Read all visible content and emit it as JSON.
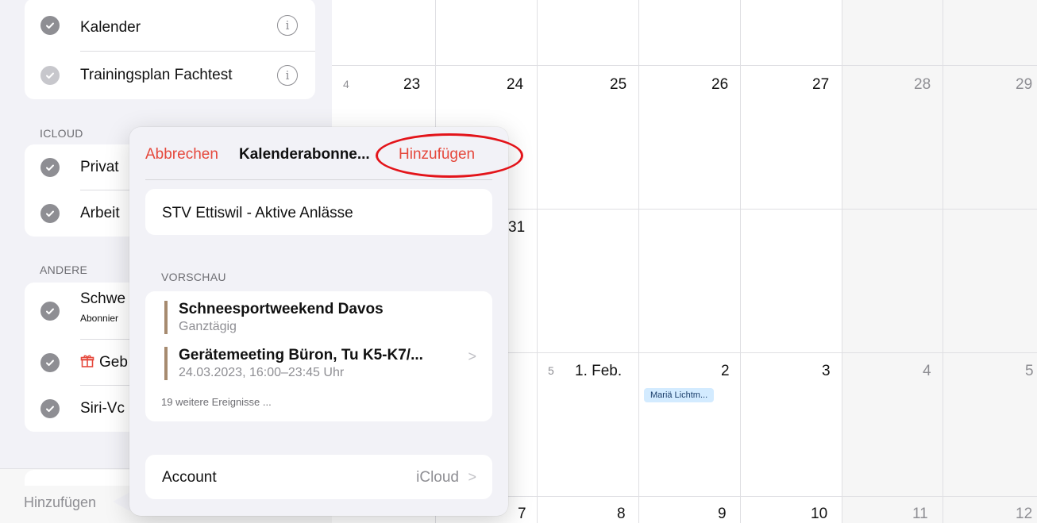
{
  "sidebar": {
    "group_top": [
      {
        "label": "Kalender",
        "checked": true
      },
      {
        "label": "Trainingsplan Fachtest",
        "checked": true
      }
    ],
    "sections": {
      "icloud": "ICLOUD",
      "other": "ANDERE"
    },
    "icloud_items": [
      {
        "label": "Privat"
      },
      {
        "label": "Arbeit"
      }
    ],
    "other_items": [
      {
        "label": "Schwe",
        "sub": "Abonnier"
      },
      {
        "label": "Geb",
        "icon": "gift-icon"
      },
      {
        "label": "Siri-Vc"
      }
    ],
    "add_button": "Hinzufügen",
    "info_glyph": "i"
  },
  "calendar": {
    "rows": [
      {
        "week": "4",
        "days": [
          "23",
          "24",
          "25",
          "26",
          "27",
          "28",
          "29"
        ]
      },
      {
        "week": "",
        "days": [
          "31"
        ]
      },
      {
        "week": "5",
        "days": [
          "1. Feb.",
          "2",
          "3",
          "4",
          "5"
        ]
      },
      {
        "week": "",
        "days": [
          "7",
          "8",
          "9",
          "10",
          "11",
          "12"
        ]
      }
    ],
    "event": "Mariä Lichtm..."
  },
  "popover": {
    "cancel_label": "Abbrechen",
    "title": "Kalenderabonne...",
    "add_label": "Hinzufügen",
    "name_value": "STV Ettiswil - Aktive Anlässe",
    "preview_header": "VORSCHAU",
    "events": [
      {
        "title": "Schneesportweekend Davos",
        "sub": "Ganztägig"
      },
      {
        "title": "Gerätemeeting Büron, Tu K5-K7/...",
        "sub": "24.03.2023, 16:00–23:45 Uhr"
      }
    ],
    "more": "19 weitere Ereignisse ...",
    "account_label": "Account",
    "account_value": "iCloud",
    "chevron": ">",
    "event_color": "#a68a6f"
  },
  "colors": {
    "accent": "#e5483c",
    "annotation": "#e3141a",
    "event_bg": "#d3ebff"
  }
}
